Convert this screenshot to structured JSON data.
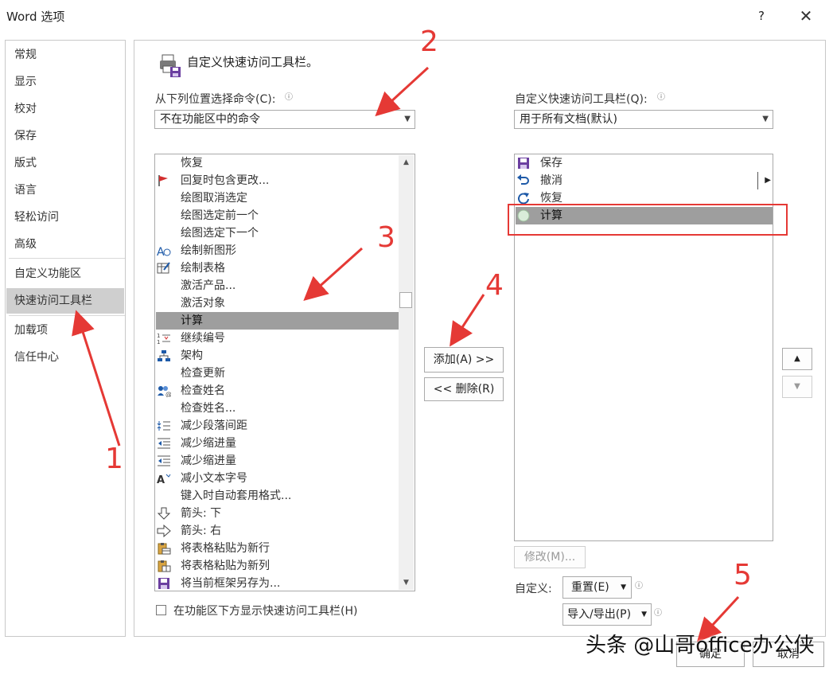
{
  "window": {
    "title": "Word 选项",
    "help": "?",
    "close": "✕"
  },
  "nav": {
    "items": [
      "常规",
      "显示",
      "校对",
      "保存",
      "版式",
      "语言",
      "轻松访问",
      "高级",
      "自定义功能区",
      "快速访问工具栏",
      "加载项",
      "信任中心"
    ],
    "selected": "快速访问工具栏"
  },
  "header": {
    "title": "自定义快速访问工具栏。"
  },
  "left": {
    "label": "从下列位置选择命令(C):",
    "combo_value": "不在功能区中的命令",
    "commands": [
      {
        "label": "恢复",
        "icon": "blank"
      },
      {
        "label": "回复时包含更改...",
        "icon": "flag-icon"
      },
      {
        "label": "绘图取消选定",
        "icon": "blank"
      },
      {
        "label": "绘图选定前一个",
        "icon": "blank"
      },
      {
        "label": "绘图选定下一个",
        "icon": "blank"
      },
      {
        "label": "绘制新图形",
        "icon": "shapes-icon"
      },
      {
        "label": "绘制表格",
        "icon": "draw-table-icon"
      },
      {
        "label": "激活产品...",
        "icon": "blank"
      },
      {
        "label": "激活对象",
        "icon": "blank"
      },
      {
        "label": "计算",
        "icon": "blank"
      },
      {
        "label": "继续编号",
        "icon": "numbering-icon"
      },
      {
        "label": "架构",
        "icon": "org-chart-icon"
      },
      {
        "label": "检查更新",
        "icon": "blank"
      },
      {
        "label": "检查姓名",
        "icon": "check-names-icon"
      },
      {
        "label": "检查姓名...",
        "icon": "blank"
      },
      {
        "label": "减少段落间距",
        "icon": "paragraph-spacing-icon"
      },
      {
        "label": "减少缩进量",
        "icon": "outdent-icon"
      },
      {
        "label": "减少缩进量",
        "icon": "outdent-icon"
      },
      {
        "label": "减小文本字号",
        "icon": "shrink-font-icon"
      },
      {
        "label": "键入时自动套用格式...",
        "icon": "blank"
      },
      {
        "label": "箭头: 下",
        "icon": "arrow-down-icon"
      },
      {
        "label": "箭头: 右",
        "icon": "arrow-right-icon"
      },
      {
        "label": "将表格粘贴为新行",
        "icon": "paste-rows-icon"
      },
      {
        "label": "将表格粘贴为新列",
        "icon": "paste-columns-icon"
      },
      {
        "label": "将当前框架另存为...",
        "icon": "save-icon"
      }
    ],
    "selected": "计算",
    "checkbox_label": "在功能区下方显示快速访问工具栏(H)"
  },
  "middle": {
    "add": "添加(A) >>",
    "remove": "<< 删除(R)"
  },
  "right": {
    "label": "自定义快速访问工具栏(Q):",
    "combo_value": "用于所有文档(默认)",
    "items": [
      {
        "label": "保存",
        "icon": "save-icon"
      },
      {
        "label": "撤消",
        "icon": "undo-icon"
      },
      {
        "label": "恢复",
        "icon": "redo-icon"
      },
      {
        "label": "计算",
        "icon": "calc-circle-icon"
      }
    ],
    "selected": "计算",
    "modify": "修改(M)...",
    "customize_label": "自定义:",
    "reset": "重置(E)",
    "import_export": "导入/导出(P)",
    "ok": "确定",
    "cancel": "取消"
  },
  "annotations": [
    "1",
    "2",
    "3",
    "4",
    "5"
  ],
  "watermark": "头条 @山哥office办公侠"
}
